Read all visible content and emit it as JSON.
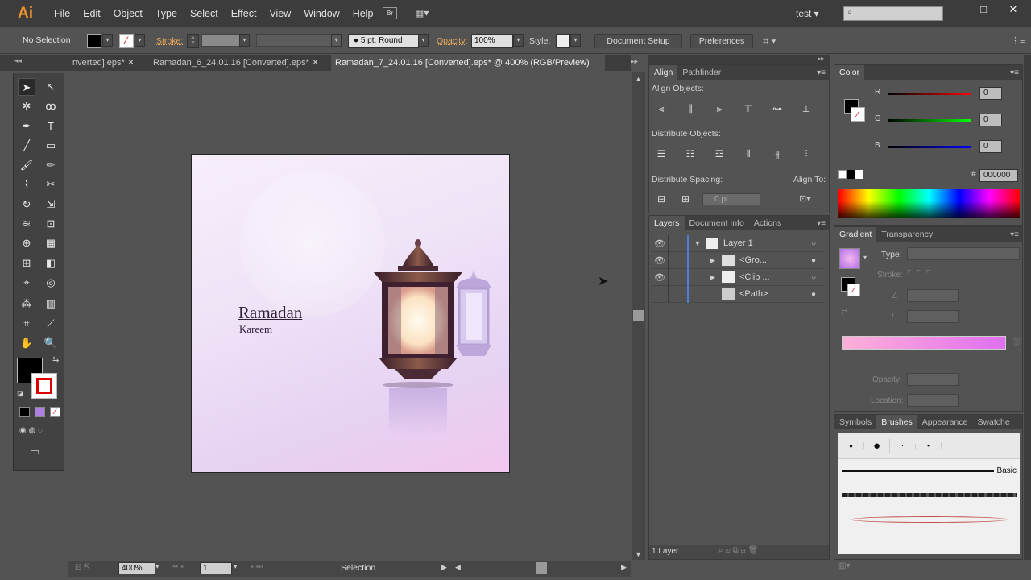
{
  "app": {
    "logo": "Ai",
    "bridge": "Br",
    "user": "test"
  },
  "menu": [
    "File",
    "Edit",
    "Object",
    "Type",
    "Select",
    "Effect",
    "View",
    "Window",
    "Help"
  ],
  "control": {
    "selection": "No Selection",
    "stroke_label": "Stroke:",
    "brush": "5 pt. Round",
    "opacity_label": "Opacity:",
    "opacity": "100%",
    "style_label": "Style:",
    "doc_setup": "Document Setup",
    "preferences": "Preferences"
  },
  "tabs": [
    {
      "label": "nverted].eps*"
    },
    {
      "label": "Ramadan_6_24.01.16 [Converted].eps*"
    },
    {
      "label": "Ramadan_7_24.01.16 [Converted].eps* @ 400% (RGB/Preview)"
    }
  ],
  "artwork": {
    "title": "Ramadan",
    "subtitle": "Kareem"
  },
  "status": {
    "zoom": "400%",
    "page": "1",
    "tool": "Selection"
  },
  "align": {
    "tabs": [
      "Align",
      "Pathfinder"
    ],
    "align_objects": "Align Objects:",
    "distribute_objects": "Distribute Objects:",
    "distribute_spacing": "Distribute Spacing:",
    "align_to": "Align To:",
    "spacing_value": "0 pt"
  },
  "layers": {
    "tabs": [
      "Layers",
      "Document Info",
      "Actions"
    ],
    "rows": [
      {
        "name": "Layer 1"
      },
      {
        "name": "<Gro..."
      },
      {
        "name": "<Clip ..."
      },
      {
        "name": "<Path>"
      }
    ],
    "footer": "1 Layer"
  },
  "color": {
    "tab": "Color",
    "r_label": "R",
    "g_label": "G",
    "b_label": "B",
    "r": "0",
    "g": "0",
    "b": "0",
    "hash": "#",
    "hex": "000000"
  },
  "gradient": {
    "tabs": [
      "Gradient",
      "Transparency"
    ],
    "type_label": "Type:",
    "stroke_label": "Stroke:",
    "opacity_label": "Opacity:",
    "location_label": "Location:"
  },
  "brushes": {
    "tabs": [
      "Symbols",
      "Brushes",
      "Appearance",
      "Swatche"
    ],
    "basic": "Basic"
  }
}
